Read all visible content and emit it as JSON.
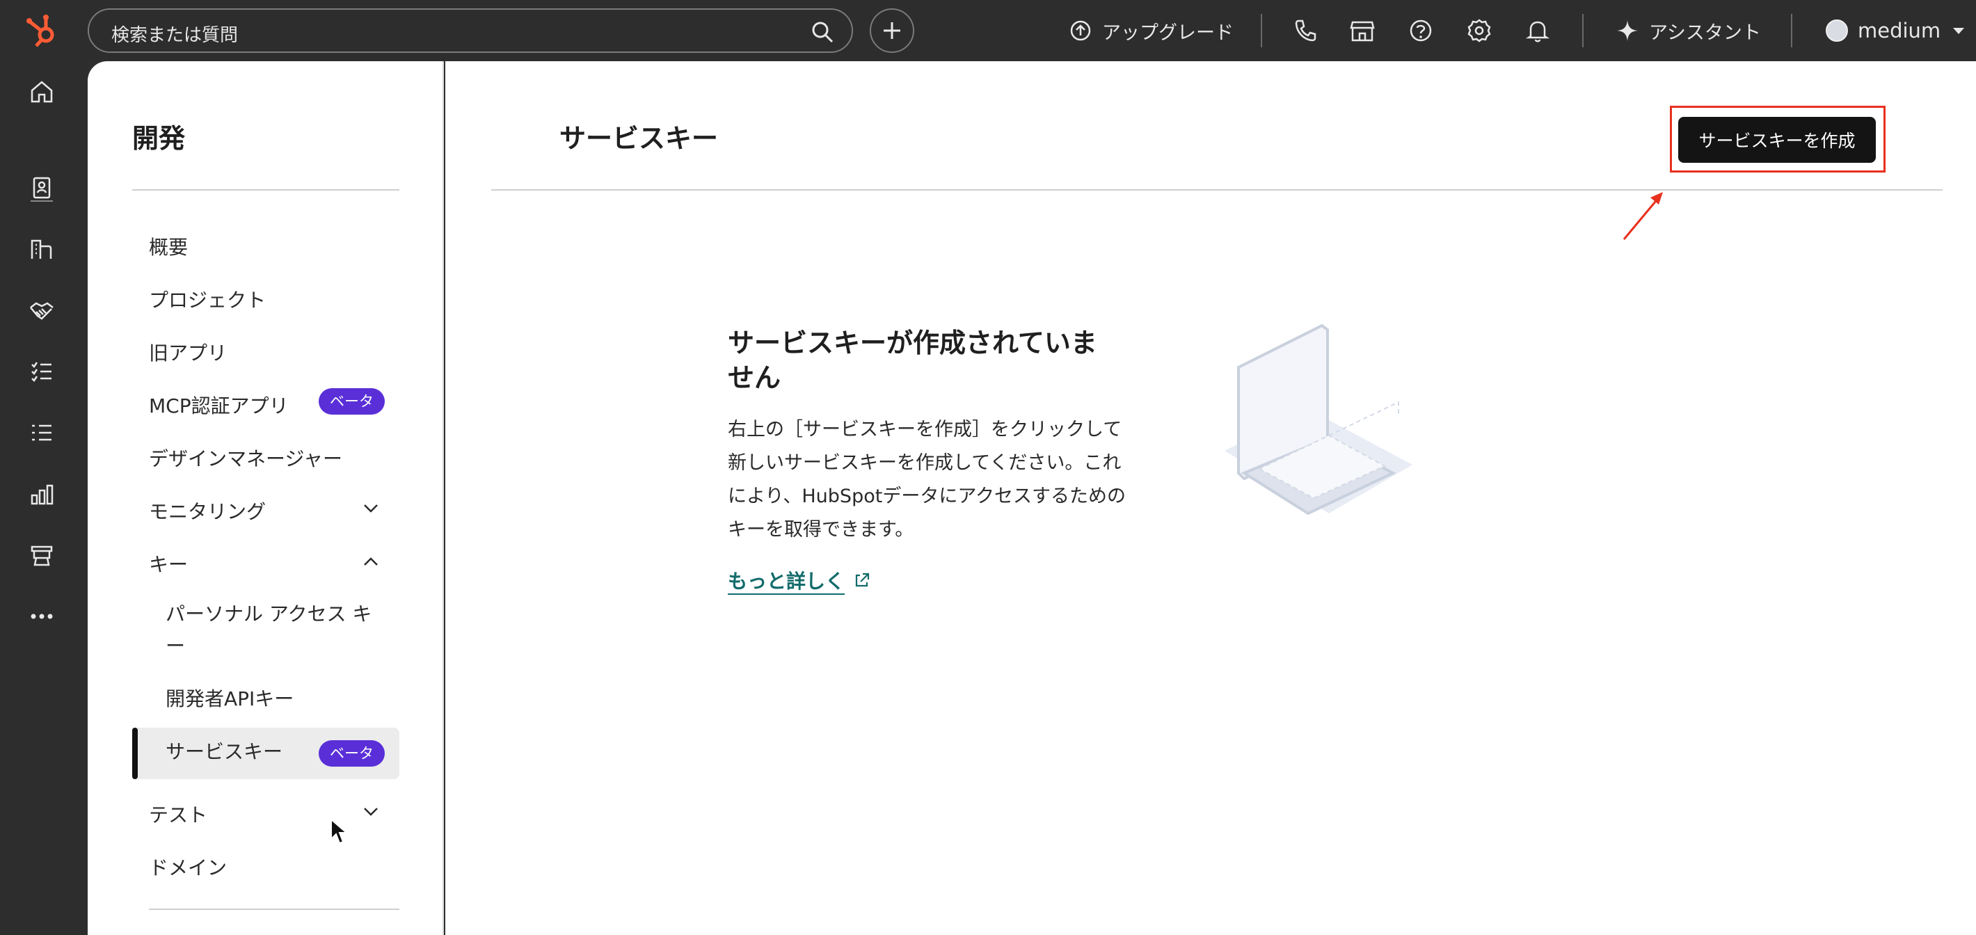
{
  "topbar": {
    "search_placeholder": "検索または質問",
    "upgrade_label": "アップグレード",
    "assistant_label": "アシスタント",
    "account_label": "medium"
  },
  "sidebar": {
    "title": "開発",
    "items": {
      "overview": "概要",
      "projects": "プロジェクト",
      "legacy_apps": "旧アプリ",
      "mcp_apps": "MCP認証アプリ",
      "mcp_badge": "ベータ",
      "design_manager": "デザインマネージャー",
      "monitoring": "モニタリング",
      "keys": "キー",
      "pat_line1": "パーソナル アクセス キ",
      "pat_line2": "ー",
      "dev_api_key": "開発者APIキー",
      "service_key": "サービスキー",
      "service_key_badge": "ベータ",
      "test": "テスト",
      "domain": "ドメイン"
    }
  },
  "main": {
    "title": "サービスキー",
    "create_button": "サービスキーを作成",
    "empty_title_line1": "サービスキーが作成されていま",
    "empty_title_line2": "せん",
    "empty_body_line1": "右上の［サービスキーを作成］をクリックして",
    "empty_body_line2": "新しいサービスキーを作成してください。これ",
    "empty_body_line3": "により、HubSpotデータにアクセスするための",
    "empty_body_line4": "キーを取得できます。",
    "learn_more": "もっと詳しく"
  },
  "colors": {
    "brand_orange": "#ff5c35",
    "badge_purple": "#5a2fd8",
    "link_teal": "#136b6b",
    "highlight_red": "#e8301e"
  }
}
